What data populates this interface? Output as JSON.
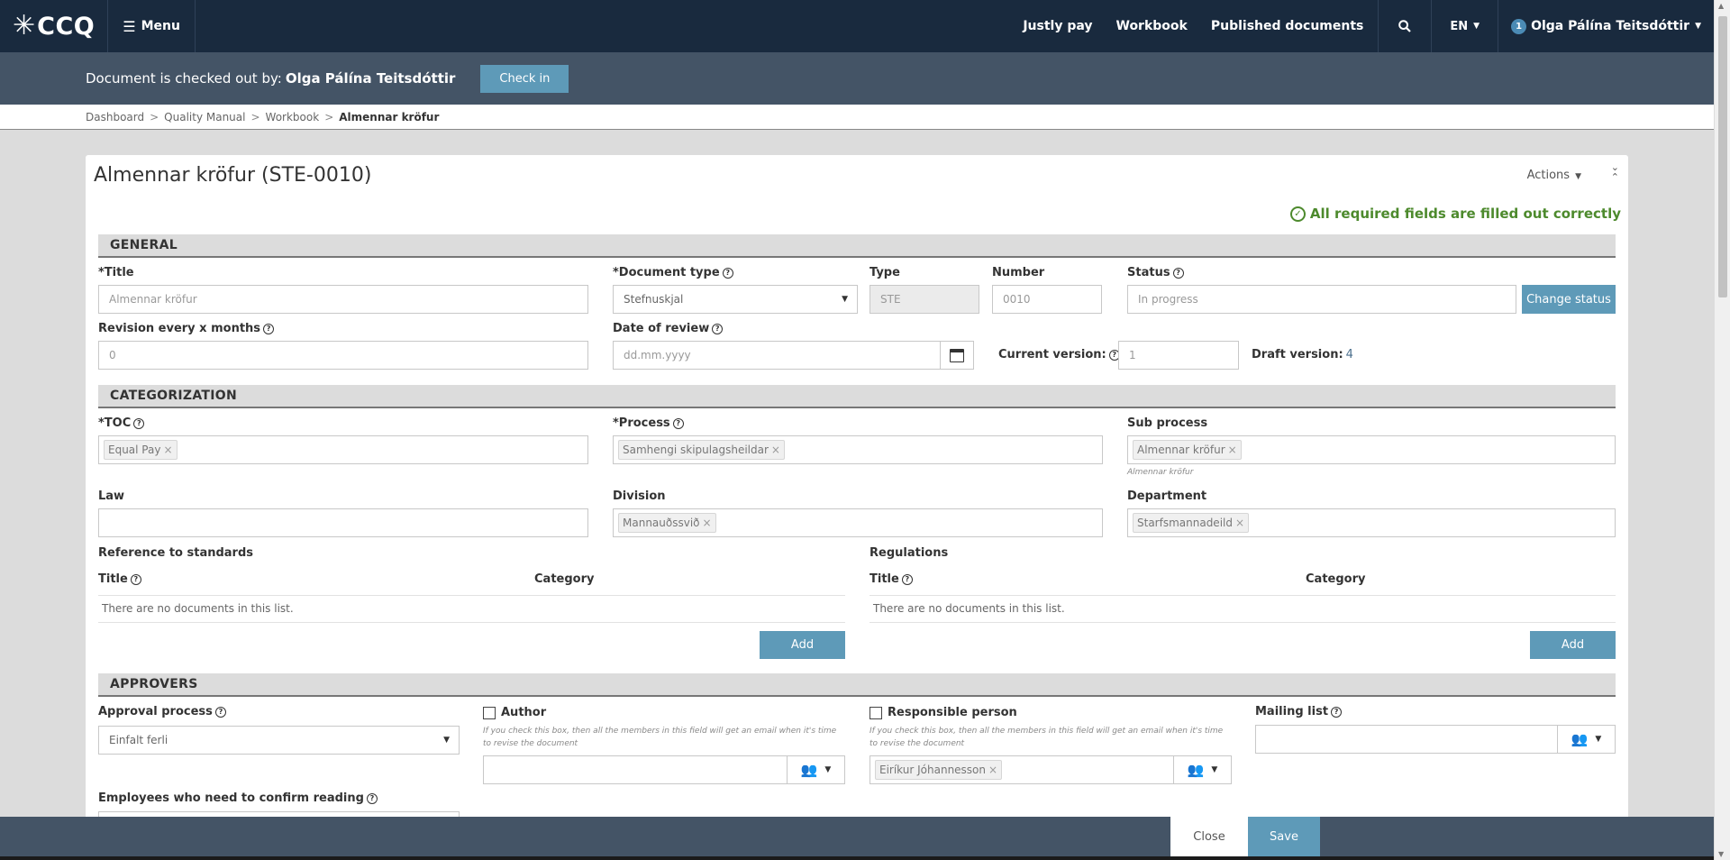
{
  "nav": {
    "brand": "CCQ",
    "menu_label": "Menu",
    "links": [
      "Justly pay",
      "Workbook",
      "Published documents"
    ],
    "lang": "EN",
    "user_badge": "1",
    "user_name": "Olga Pálína Teitsdóttir",
    "icons": {
      "brand": "asterisk-logo-icon",
      "menu": "hamburger-icon",
      "search": "search-icon"
    }
  },
  "checkout": {
    "text": "Document is checked out by:",
    "user": "Olga Pálína Teitsdóttir",
    "checkin_label": "Check in"
  },
  "breadcrumb": {
    "items": [
      "Dashboard",
      "Quality Manual",
      "Workbook"
    ],
    "current": "Almennar kröfur"
  },
  "card": {
    "title": "Almennar kröfur (STE-0010)",
    "actions_label": "Actions",
    "validation_msg": "All required fields are filled out correctly",
    "validation_color": "#4d8a2d"
  },
  "general": {
    "heading": "GENERAL",
    "title_label": "*Title",
    "title_value": "Almennar kröfur",
    "doctype_label": "*Document type",
    "doctype_value": "Stefnuskjal",
    "type_label": "Type",
    "type_value": "STE",
    "number_label": "Number",
    "number_value": "0010",
    "status_label": "Status",
    "status_value": "In progress",
    "change_status_label": "Change status",
    "revision_label": "Revision every x months",
    "revision_value": "0",
    "review_date_label": "Date of review",
    "review_date_placeholder": "dd.mm.yyyy",
    "current_version_label": "Current version:",
    "current_version_value": "1",
    "draft_version_label": "Draft version:",
    "draft_version_value": "4"
  },
  "categorization": {
    "heading": "CATEGORIZATION",
    "toc_label": "*TOC",
    "toc_tag": "Equal Pay",
    "process_label": "*Process",
    "process_tag": "Samhengi skipulagsheildar",
    "subprocess_label": "Sub process",
    "subprocess_tag": "Almennar kröfur",
    "subprocess_hint": "Almennar kröfur",
    "law_label": "Law",
    "division_label": "Division",
    "division_tag": "Mannauðssvið",
    "department_label": "Department",
    "department_tag": "Starfsmannadeild",
    "standards_heading": "Reference to standards",
    "regulations_heading": "Regulations",
    "col_title": "Title",
    "col_category": "Category",
    "empty_text": "There are no documents in this list.",
    "add_label": "Add"
  },
  "approvers": {
    "heading": "APPROVERS",
    "approval_process_label": "Approval process",
    "approval_process_value": "Einfalt ferli",
    "author_label": "Author",
    "responsible_label": "Responsible person",
    "checkbox_hint": "If you check this box, then all the members in this field will get an email when it's time to revise the document",
    "responsible_tag": "Eiríkur Jóhannesson",
    "mailing_label": "Mailing list",
    "confirm_reading_label": "Employees who need to confirm reading"
  },
  "footer": {
    "close_label": "Close",
    "save_label": "Save"
  },
  "colors": {
    "nav_bg": "#192a3e",
    "bar_bg": "#445466",
    "accent": "#5e9ab8"
  }
}
